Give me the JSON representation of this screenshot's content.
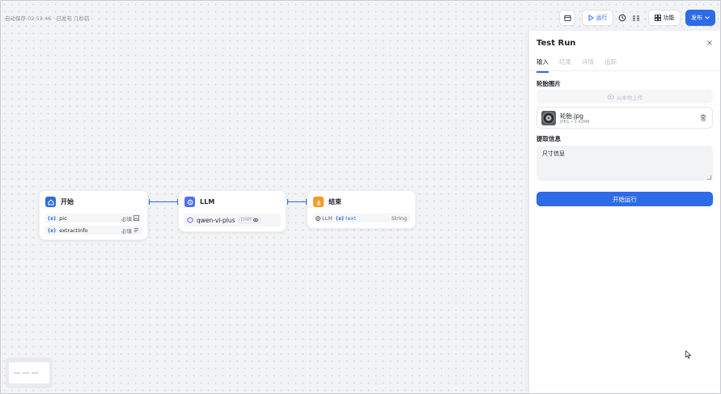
{
  "colors": {
    "accent": "#2e6be6",
    "start": "#2e6be6",
    "llm": "#4f6ef7",
    "end": "#f59a23"
  },
  "header": {
    "autosave": "自动保存 02:53:46 · 已发布 几秒前"
  },
  "toolbar": {
    "run_label": "运行",
    "features_label": "功能",
    "publish_label": "发布"
  },
  "nodes": {
    "start": {
      "title": "开始",
      "vars": [
        {
          "prefix": "(x)",
          "name": "pic",
          "required": "必填"
        },
        {
          "prefix": "(x)",
          "name": "extractInfo",
          "required": "必填"
        }
      ]
    },
    "llm": {
      "title": "LLM",
      "model": "qwen-vl-plus",
      "model_tag": "CHAT"
    },
    "end": {
      "title": "结束",
      "source": "LLM",
      "prefix": "(x)",
      "var": "text",
      "type": "String"
    }
  },
  "panel": {
    "title": "Test Run",
    "close": "×",
    "tabs": [
      "输入",
      "结果",
      "详情",
      "追踪"
    ],
    "field1_label": "轮胎图片",
    "upload_label": "从本地上传",
    "file": {
      "name": "轮胎.jpg",
      "meta": "JPEG • 1.42MB"
    },
    "field2_label": "提取信息",
    "field2_value": "尺寸信息",
    "run_button": "开始运行"
  }
}
